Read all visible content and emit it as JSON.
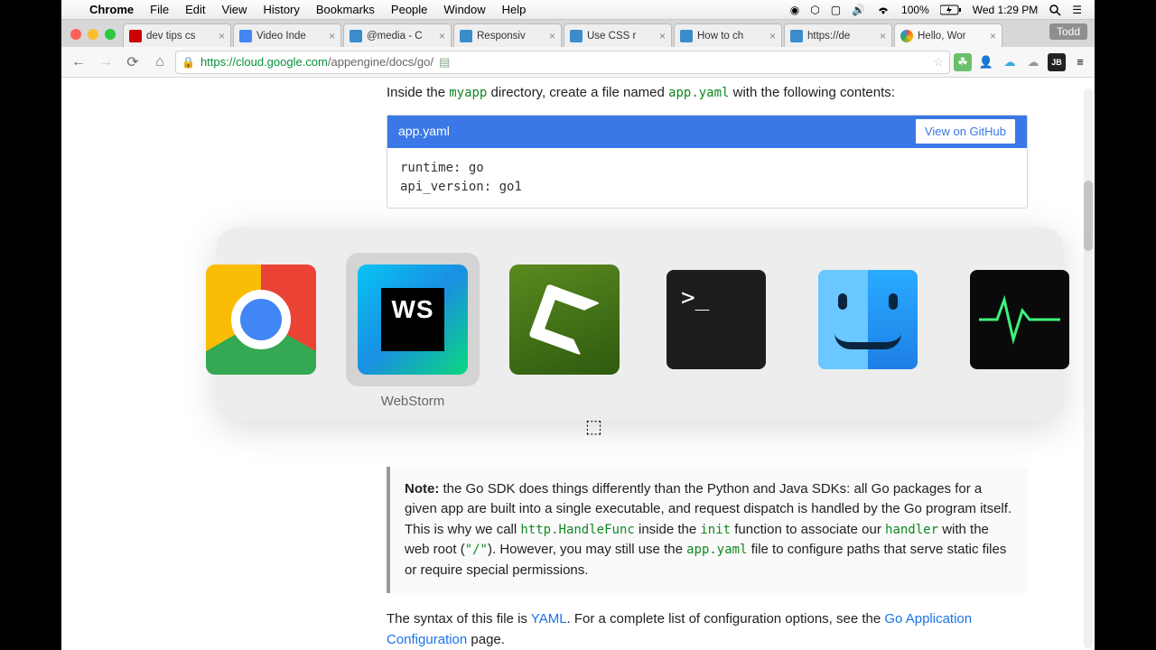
{
  "menubar": {
    "app": "Chrome",
    "items": [
      "File",
      "Edit",
      "View",
      "History",
      "Bookmarks",
      "People",
      "Window",
      "Help"
    ],
    "battery": "100%",
    "clock": "Wed 1:29 PM"
  },
  "chrome": {
    "profile": "Todd",
    "tabs": [
      {
        "title": "dev tips cs",
        "fav": "#cc0000"
      },
      {
        "title": "Video Inde",
        "fav": "#4285f4"
      },
      {
        "title": "@media - C",
        "fav": "#3b8ccb"
      },
      {
        "title": "Responsiv",
        "fav": "#3b8ccb"
      },
      {
        "title": "Use CSS r",
        "fav": "#3b8ccb"
      },
      {
        "title": "How to ch",
        "fav": "#3b8ccb"
      },
      {
        "title": "https://de",
        "fav": "#3b8ccb"
      },
      {
        "title": "Hello, Wor",
        "fav": "#4285f4"
      }
    ],
    "active_tab": 7,
    "url_host": "https://cloud.google.com",
    "url_path": "/appengine/docs/go/"
  },
  "doc": {
    "intro_pre": "Inside the ",
    "intro_code1": "myapp",
    "intro_mid": " directory, create a file named ",
    "intro_code2": "app.yaml",
    "intro_post": " with the following contents:",
    "file_label": "app.yaml",
    "github_btn": "View on GitHub",
    "code": "runtime: go\napi_version: go1",
    "note_label": "Note:",
    "note_1": " the Go SDK does things differently than the Python and Java SDKs: all Go packages for a given app are built into a single executable, and request dispatch is handled by the Go program itself. This is why we call ",
    "note_c1": "http.HandleFunc",
    "note_2": " inside the ",
    "note_c2": "init",
    "note_3": " function to associate our ",
    "note_c3": "handler",
    "note_4": " with the web root (",
    "note_c4": "\"/\"",
    "note_5": "). However, you may still use the ",
    "note_c5": "app.yaml",
    "note_6": " file to configure paths that serve static files or require special permissions.",
    "para_1": "The syntax of this file is ",
    "para_link1": "YAML",
    "para_2": ". For a complete list of configuration options, see the ",
    "para_link2": "Go Application Configuration",
    "para_3": " page."
  },
  "hud": {
    "apps": [
      {
        "name": "Google Chrome"
      },
      {
        "name": "WebStorm"
      },
      {
        "name": "Camtasia"
      },
      {
        "name": "Terminal"
      },
      {
        "name": "Finder"
      },
      {
        "name": "Activity Monitor"
      }
    ],
    "selected": 1,
    "label": "WebStorm"
  }
}
